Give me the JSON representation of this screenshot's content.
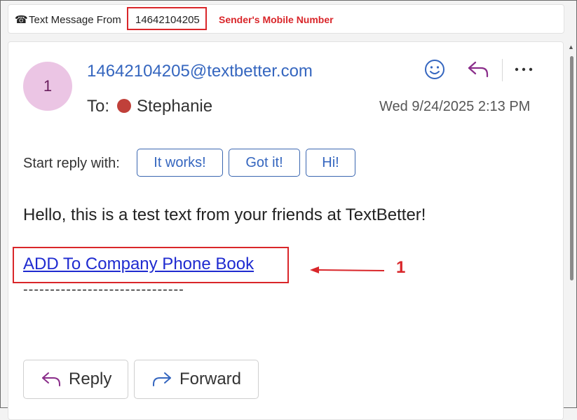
{
  "subject_bar": {
    "phone_icon": "phone-icon",
    "prefix": "Text Message From",
    "sender_number": "14642104205",
    "annotation_label": "Sender's Mobile Number"
  },
  "message": {
    "avatar_initial": "1",
    "from": "14642104205@textbetter.com",
    "to_label": "To:",
    "to_name": "Stephanie",
    "date": "Wed 9/24/2025 2:13 PM",
    "body": "Hello, this is a test text from your friends at TextBetter!",
    "link_text": "ADD To Company Phone Book",
    "separator": "------------------------------"
  },
  "quick_reply": {
    "label": "Start reply with:",
    "options": [
      "It works!",
      "Got it!",
      "Hi!"
    ]
  },
  "annotation": {
    "number": "1"
  },
  "actions": {
    "reply": "Reply",
    "forward": "Forward"
  },
  "colors": {
    "accent": "#3566bf",
    "annotation": "#d9262a",
    "avatar_bg": "#ebc5e4",
    "link": "#1f2bd0"
  }
}
